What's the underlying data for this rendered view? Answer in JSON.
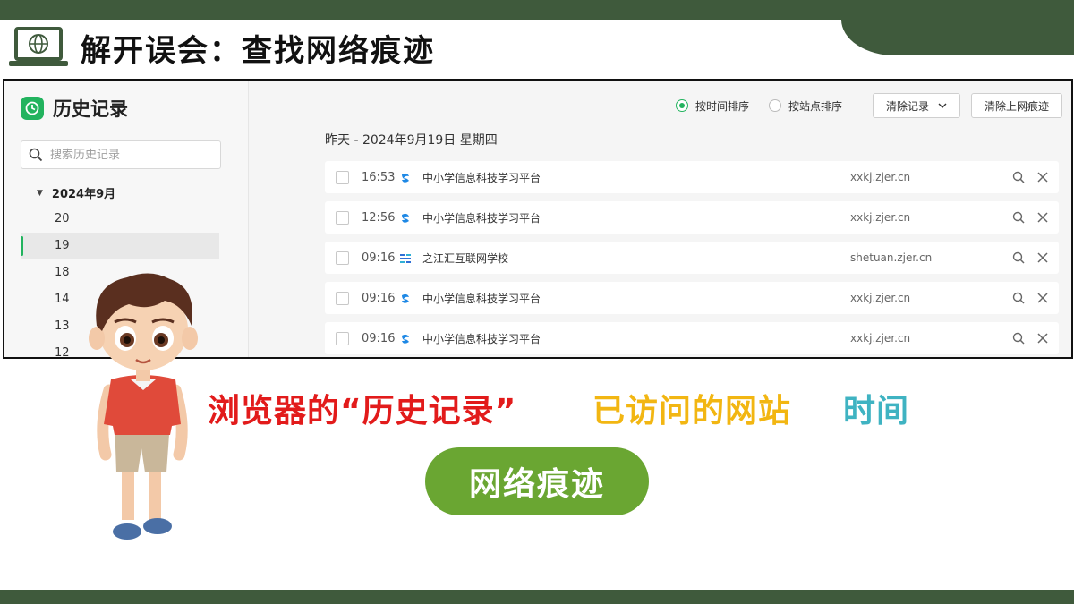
{
  "slide": {
    "title": "解开误会：查找网络痕迹",
    "colors": {
      "band": "#3f5a3c",
      "accent_green": "#6aa632",
      "red": "#e21b1b",
      "yellow": "#f2b612",
      "teal": "#3fb3c2"
    }
  },
  "app": {
    "title": "历史记录",
    "search_placeholder": "搜索历史记录",
    "tree": {
      "month": "2024年9月",
      "days": [
        "20",
        "19",
        "18",
        "14",
        "13",
        "12"
      ],
      "selected": "19"
    },
    "toolbar": {
      "sort_time": "按时间排序",
      "sort_site": "按站点排序",
      "clear": "清除记录",
      "clear_traces": "清除上网痕迹"
    },
    "date_heading": "昨天 - 2024年9月19日 星期四",
    "rows": [
      {
        "time": "16:53",
        "site": "中小学信息科技学习平台",
        "domain": "xxkj.zjer.cn",
        "icon": "xxkj-logo-icon"
      },
      {
        "time": "12:56",
        "site": "中小学信息科技学习平台",
        "domain": "xxkj.zjer.cn",
        "icon": "xxkj-logo-icon"
      },
      {
        "time": "09:16",
        "site": "之江汇互联网学校",
        "domain": "shetuan.zjer.cn",
        "icon": "zjh-logo-icon"
      },
      {
        "time": "09:16",
        "site": "中小学信息科技学习平台",
        "domain": "xxkj.zjer.cn",
        "icon": "xxkj-logo-icon"
      },
      {
        "time": "09:16",
        "site": "中小学信息科技学习平台",
        "domain": "xxkj.zjer.cn",
        "icon": "xxkj-logo-icon"
      }
    ]
  },
  "callouts": {
    "phrase1": "浏览器的“历史记录”",
    "phrase2": "已访问的网站",
    "phrase3": "时间",
    "button": "网络痕迹"
  }
}
